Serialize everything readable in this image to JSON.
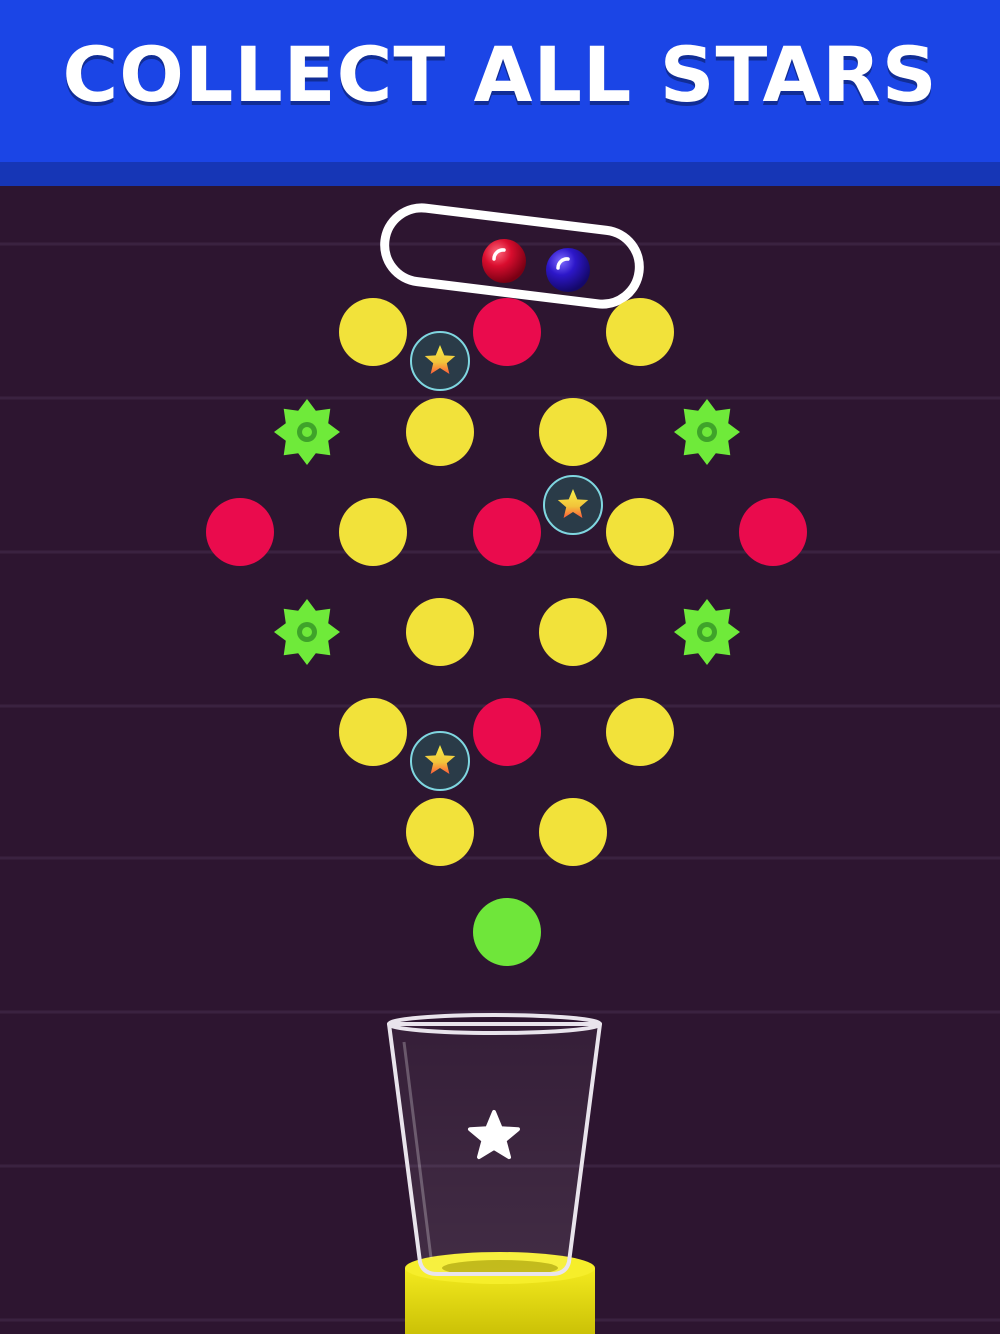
{
  "banner": {
    "title": "COLLECT ALL STARS"
  },
  "colors": {
    "banner": "#1b45e6",
    "background": "#2d1530",
    "yellow_peg": "#f2e23a",
    "red_peg": "#ea0b4d",
    "green_gear": "#6fea3a",
    "green_ball": "#6fe63a",
    "red_ball": "#d90d2e",
    "purple_ball": "#2d17c9",
    "pedestal": "#e8df10"
  },
  "icons": {
    "star": "star-icon",
    "gear": "spiked-gear-icon",
    "cup": "glass-cup-icon"
  }
}
